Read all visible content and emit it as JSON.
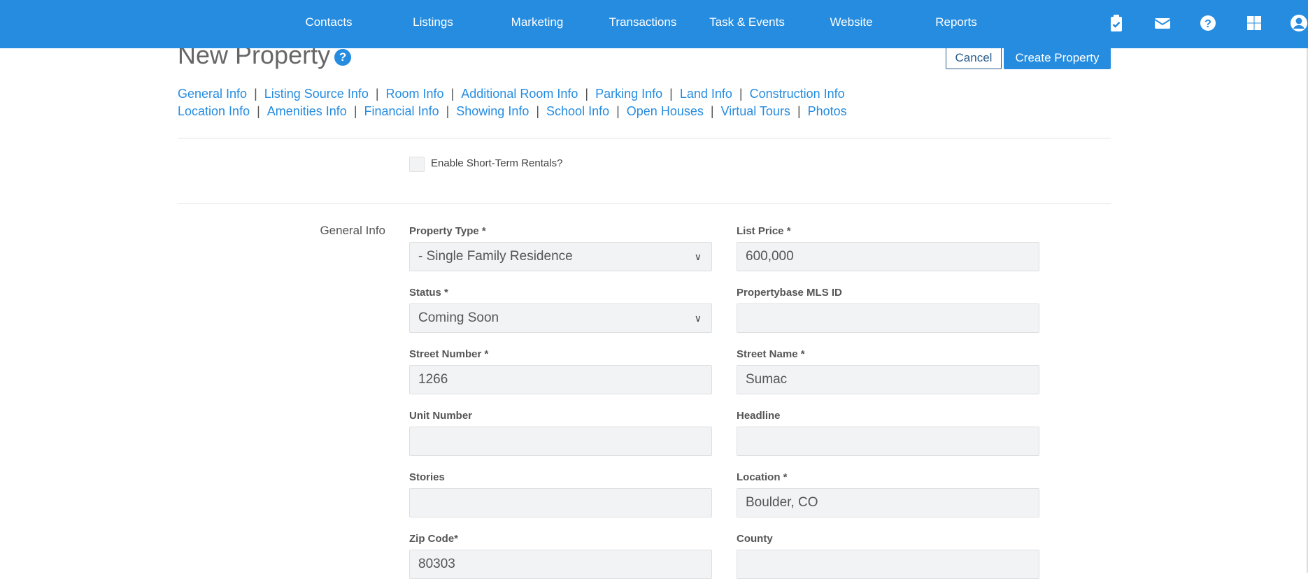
{
  "nav": {
    "items": [
      "Contacts",
      "Listings",
      "Marketing",
      "Transactions",
      "Task & Events",
      "Website",
      "Reports"
    ],
    "icons": [
      "clipboard-check-icon",
      "envelope-icon",
      "question-circle-icon",
      "grid-icon",
      "user-circle-icon"
    ]
  },
  "page": {
    "title": "New Property",
    "cancel": "Cancel",
    "create": "Create Property"
  },
  "links_row1": [
    "General Info",
    "Listing Source Info",
    "Room Info",
    "Additional Room Info",
    "Parking Info",
    "Land Info",
    "Construction Info"
  ],
  "links_row2": [
    "Location Info",
    "Amenities Info",
    "Financial Info",
    "Showing Info",
    "School Info",
    "Open Houses",
    "Virtual Tours",
    "Photos"
  ],
  "short_term": {
    "label": "Enable Short-Term Rentals?",
    "checked": false
  },
  "section": "General Info",
  "fields": [
    {
      "label": "Property Type *",
      "value": "- Single Family Residence",
      "type": "select"
    },
    {
      "label": "List Price *",
      "value": "600,000",
      "type": "text"
    },
    {
      "label": "Status *",
      "value": "Coming Soon",
      "type": "select"
    },
    {
      "label": "Propertybase MLS ID",
      "value": "",
      "type": "text"
    },
    {
      "label": "Street Number *",
      "value": "1266",
      "type": "text"
    },
    {
      "label": "Street Name *",
      "value": "Sumac",
      "type": "text"
    },
    {
      "label": "Unit Number",
      "value": "",
      "type": "text"
    },
    {
      "label": "Headline",
      "value": "",
      "type": "text"
    },
    {
      "label": "Stories",
      "value": "",
      "type": "text"
    },
    {
      "label": "Location *",
      "value": "Boulder, CO",
      "type": "text"
    },
    {
      "label": "Zip Code*",
      "value": "80303",
      "type": "text"
    },
    {
      "label": "County",
      "value": "",
      "type": "text"
    }
  ]
}
